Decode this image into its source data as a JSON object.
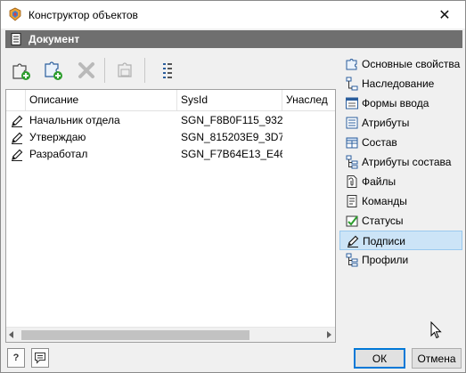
{
  "window": {
    "title": "Конструктор объектов",
    "close_glyph": "✕"
  },
  "header": {
    "title": "Документ"
  },
  "toolbar": {
    "buttons": [
      {
        "name": "add-puzzle",
        "icon": "puzzle-add-icon"
      },
      {
        "name": "add-puzzle-alt",
        "icon": "puzzle-add-alt-icon"
      },
      {
        "name": "delete",
        "icon": "delete-x-icon"
      },
      {
        "name": "copy",
        "icon": "copy-puzzle-icon"
      },
      {
        "name": "list-settings",
        "icon": "list-settings-icon"
      }
    ]
  },
  "grid": {
    "columns": [
      "Описание",
      "SysId",
      "Унаслед"
    ],
    "rows": [
      {
        "icon": "pencil-icon",
        "description": "Начальник отдела",
        "sysid": "SGN_F8B0F115_932..."
      },
      {
        "icon": "pencil-icon",
        "description": "Утверждаю",
        "sysid": "SGN_815203E9_3D7..."
      },
      {
        "icon": "pencil-icon",
        "description": "Разработал",
        "sysid": "SGN_F7B64E13_E46..."
      }
    ]
  },
  "sidebar": {
    "items": [
      {
        "label": "Основные свойства",
        "icon": "properties-icon",
        "selected": false
      },
      {
        "label": "Наследование",
        "icon": "inheritance-icon",
        "selected": false
      },
      {
        "label": "Формы ввода",
        "icon": "input-form-icon",
        "selected": false
      },
      {
        "label": "Атрибуты",
        "icon": "attributes-icon",
        "selected": false
      },
      {
        "label": "Состав",
        "icon": "composition-icon",
        "selected": false
      },
      {
        "label": "Атрибуты состава",
        "icon": "composition-attributes-icon",
        "selected": false
      },
      {
        "label": "Файлы",
        "icon": "files-icon",
        "selected": false
      },
      {
        "label": "Команды",
        "icon": "commands-icon",
        "selected": false
      },
      {
        "label": "Статусы",
        "icon": "statuses-icon",
        "selected": false
      },
      {
        "label": "Подписи",
        "icon": "signatures-icon",
        "selected": true
      },
      {
        "label": "Профили",
        "icon": "profiles-icon",
        "selected": false
      }
    ]
  },
  "footer": {
    "help_label": "?",
    "ok_label": "ОК",
    "cancel_label": "Отмена"
  },
  "colors": {
    "header_band": "#6f6f6f",
    "selection": "#cce4f7",
    "accent": "#0078d7"
  }
}
